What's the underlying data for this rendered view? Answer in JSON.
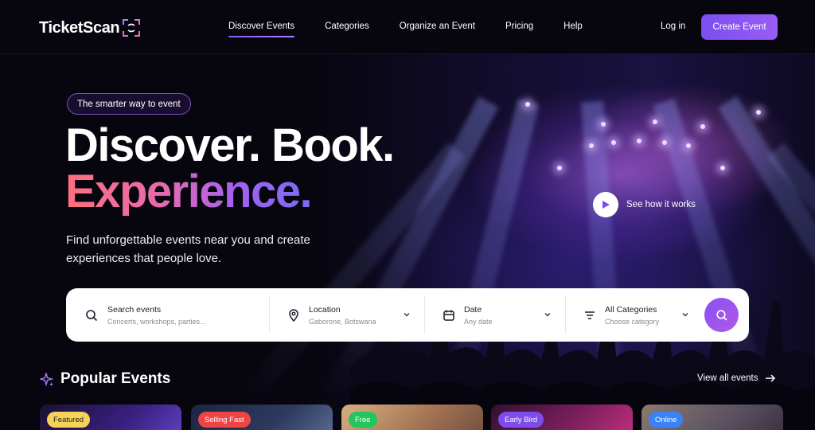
{
  "brand": {
    "name": "TicketScan",
    "accent": "#8a5cf6"
  },
  "nav": {
    "items": [
      {
        "label": "Discover Events",
        "active": true
      },
      {
        "label": "Categories",
        "active": false
      },
      {
        "label": "Organize an Event",
        "active": false
      },
      {
        "label": "Pricing",
        "active": false
      },
      {
        "label": "Help",
        "active": false
      }
    ],
    "login": "Log in",
    "create": "Create Event"
  },
  "hero": {
    "tagline": "The smarter way to event",
    "headline_1": "Discover. Book.",
    "headline_2": "Experience.",
    "subtitle": "Find unforgettable events near you and create experiences that people love.",
    "video_label": "See how it works"
  },
  "search": {
    "query": {
      "label": "Search events",
      "placeholder": "Concerts, workshops, parties..."
    },
    "location": {
      "label": "Location",
      "value": "Gaborone, Botswana"
    },
    "date": {
      "label": "Date",
      "value": "Any date"
    },
    "category": {
      "label": "All Categories",
      "value": "Choose category"
    }
  },
  "popular": {
    "title": "Popular Events",
    "view_all": "View all events",
    "cards": [
      {
        "badge": "Featured",
        "badge_color": "#f5d35a",
        "badge_text_color": "#1a1a1a"
      },
      {
        "badge": "Selling Fast",
        "badge_color": "#ef4444",
        "badge_text_color": "#ffffff"
      },
      {
        "badge": "Free",
        "badge_color": "#22c55e",
        "badge_text_color": "#ffffff"
      },
      {
        "badge": "Early Bird",
        "badge_color": "#7c4dea",
        "badge_text_color": "#ffffff"
      },
      {
        "badge": "Online",
        "badge_color": "#3b82f6",
        "badge_text_color": "#ffffff"
      }
    ]
  }
}
